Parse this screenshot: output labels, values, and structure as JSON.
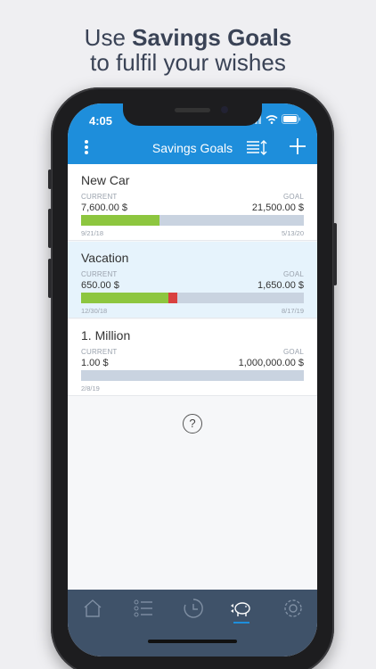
{
  "promo": {
    "line1_prefix": "Use ",
    "line1_bold": "Savings Goals",
    "line2": "to fulfil your wishes"
  },
  "status": {
    "time": "4:05"
  },
  "navbar": {
    "title": "Savings Goals",
    "menu_icon": "more-vert-icon",
    "sort_icon": "sort-icon",
    "add_icon": "plus-icon"
  },
  "labels": {
    "current": "CURRENT",
    "goal": "GOAL"
  },
  "goals": [
    {
      "name": "New Car",
      "current": "7,600.00 $",
      "goal": "21,500.00 $",
      "start": "9/21/18",
      "end": "5/13/20",
      "progress": 0.3535,
      "overdue": 0,
      "selected": false
    },
    {
      "name": "Vacation",
      "current": "650.00 $",
      "goal": "1,650.00 $",
      "start": "12/30/18",
      "end": "8/17/19",
      "progress": 0.3939,
      "overdue": 0.04,
      "selected": true
    },
    {
      "name": "1. Million",
      "current": "1.00 $",
      "goal": "1,000,000.00 $",
      "start": "2/8/19",
      "end": "",
      "progress": 1e-06,
      "overdue": 0,
      "selected": false
    }
  ],
  "help": {
    "label": "?"
  },
  "tabs": [
    {
      "name": "home-icon"
    },
    {
      "name": "list-icon"
    },
    {
      "name": "history-icon"
    },
    {
      "name": "piggy-bank-icon",
      "active": true
    },
    {
      "name": "gear-icon"
    }
  ],
  "colors": {
    "accent": "#1e8edb",
    "progress": "#8dc63f",
    "overdue": "#d9413f",
    "tabbar": "#3f5269"
  }
}
